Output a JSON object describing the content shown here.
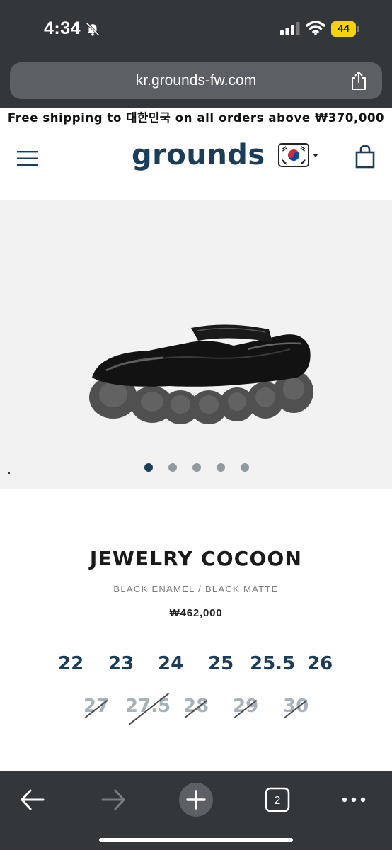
{
  "status_bar": {
    "time": "4:34",
    "battery": "44"
  },
  "browser": {
    "url": "kr.grounds-fw.com",
    "tabs_count": "2"
  },
  "promo": {
    "text": "Free shipping to 대한민국 on all orders above ₩370,000"
  },
  "header": {
    "logo": "grounds"
  },
  "gallery": {
    "image_count": 5,
    "active_index": 0
  },
  "product": {
    "name": "JEWELRY COCOON",
    "variant": "BLACK ENAMEL / BLACK MATTE",
    "price": "₩462,000",
    "sizes_available": [
      "22",
      "23",
      "24",
      "25",
      "25.5",
      "26"
    ],
    "sizes_sold_out": [
      "27",
      "27.5",
      "28",
      "29",
      "30"
    ]
  },
  "colors": {
    "chrome": "#34373a",
    "brand": "#1c3d57",
    "soldout": "#a7b2ba"
  },
  "icons": {
    "silent": "bell-slash-icon",
    "menu": "hamburger-menu-icon",
    "cart": "shopping-bag-icon",
    "share": "share-icon",
    "back": "arrow-left-icon",
    "forward": "arrow-right-icon",
    "new_tab": "plus-icon",
    "more": "more-dots-icon"
  }
}
